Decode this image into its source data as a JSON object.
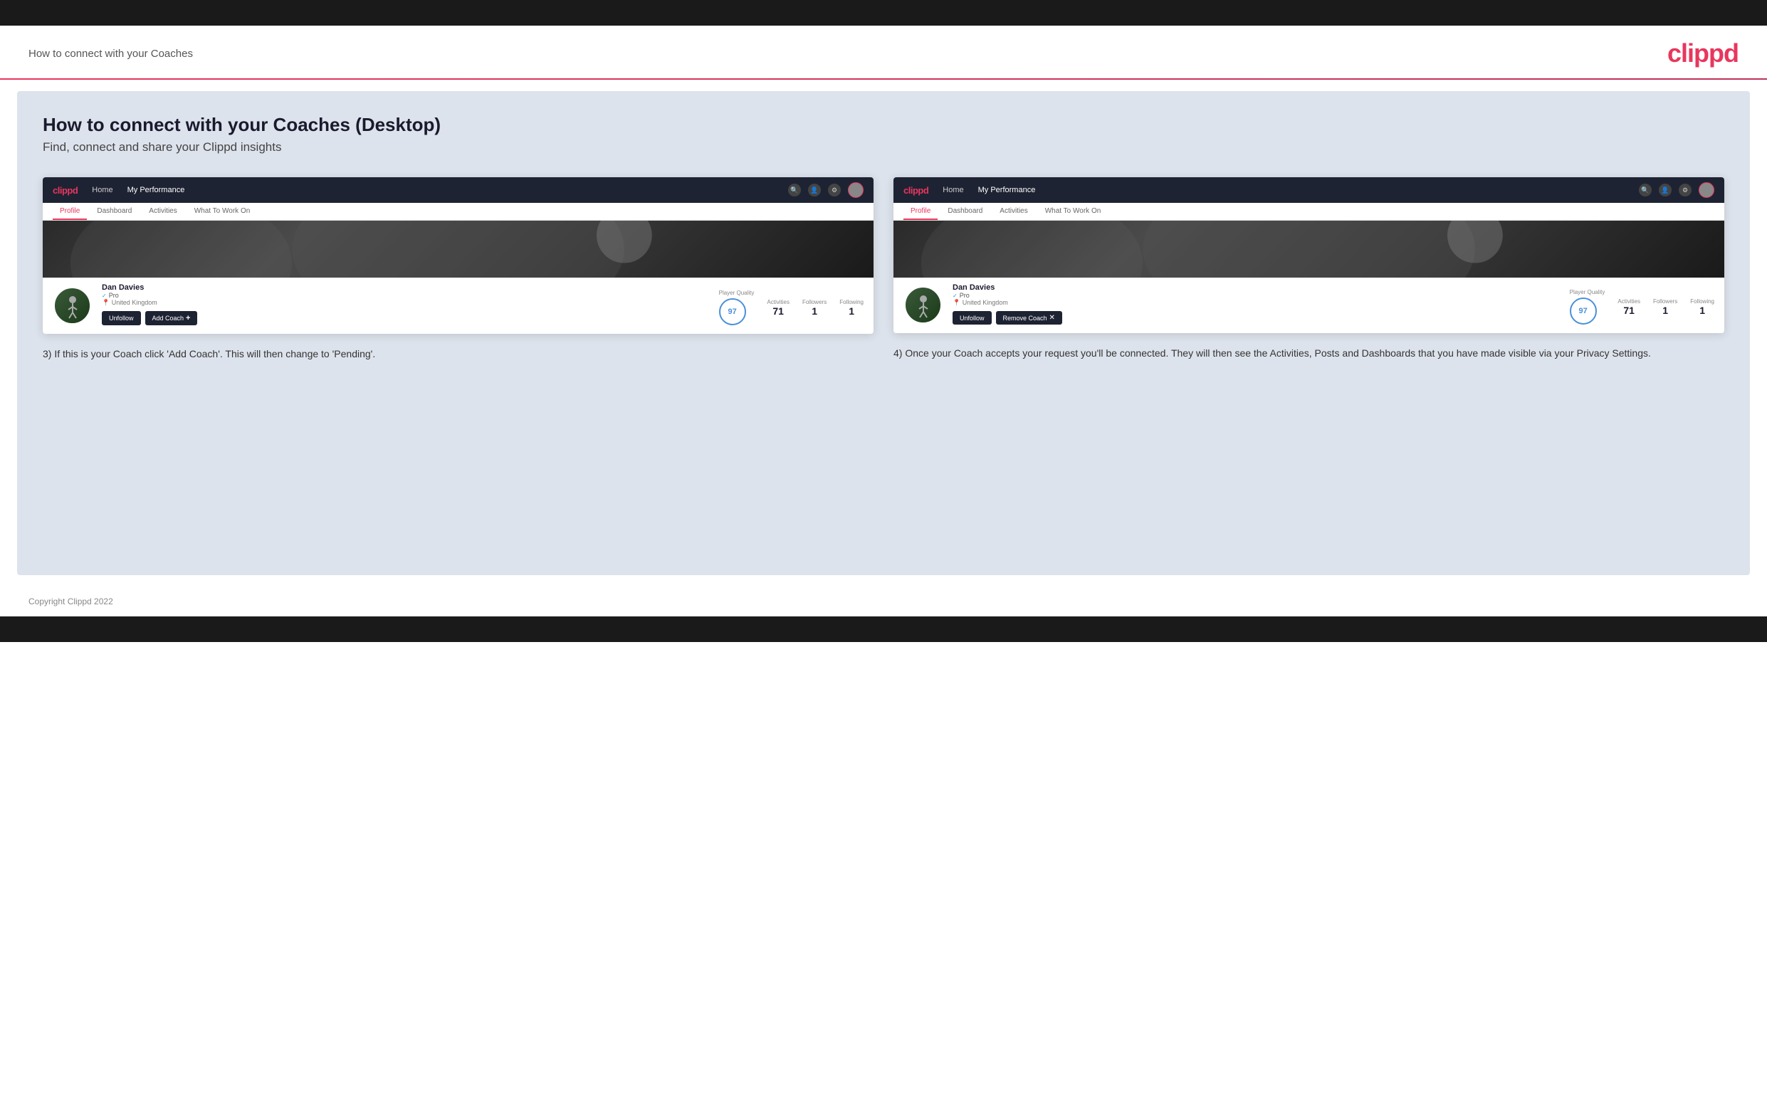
{
  "topBar": {},
  "header": {
    "title": "How to connect with your Coaches",
    "logo": "clippd"
  },
  "main": {
    "heading": "How to connect with your Coaches (Desktop)",
    "subheading": "Find, connect and share your Clippd insights",
    "screenshot1": {
      "nav": {
        "logo": "clippd",
        "items": [
          "Home",
          "My Performance"
        ]
      },
      "tabs": [
        "Profile",
        "Dashboard",
        "Activities",
        "What To Work On"
      ],
      "activeTab": "Profile",
      "profile": {
        "name": "Dan Davies",
        "role": "Pro",
        "location": "United Kingdom",
        "playerQuality": 97,
        "activities": 71,
        "followers": 1,
        "following": 1
      },
      "buttons": {
        "unfollow": "Unfollow",
        "addCoach": "Add Coach"
      },
      "labels": {
        "playerQuality": "Player Quality",
        "activities": "Activities",
        "followers": "Followers",
        "following": "Following"
      }
    },
    "screenshot2": {
      "nav": {
        "logo": "clippd",
        "items": [
          "Home",
          "My Performance"
        ]
      },
      "tabs": [
        "Profile",
        "Dashboard",
        "Activities",
        "What To Work On"
      ],
      "activeTab": "Profile",
      "profile": {
        "name": "Dan Davies",
        "role": "Pro",
        "location": "United Kingdom",
        "playerQuality": 97,
        "activities": 71,
        "followers": 1,
        "following": 1
      },
      "buttons": {
        "unfollow": "Unfollow",
        "removeCoach": "Remove Coach"
      },
      "labels": {
        "playerQuality": "Player Quality",
        "activities": "Activities",
        "followers": "Followers",
        "following": "Following"
      }
    },
    "desc1": "3) If this is your Coach click 'Add Coach'. This will then change to 'Pending'.",
    "desc2": "4) Once your Coach accepts your request you'll be connected. They will then see the Activities, Posts and Dashboards that you have made visible via your Privacy Settings."
  },
  "footer": {
    "copyright": "Copyright Clippd 2022"
  }
}
